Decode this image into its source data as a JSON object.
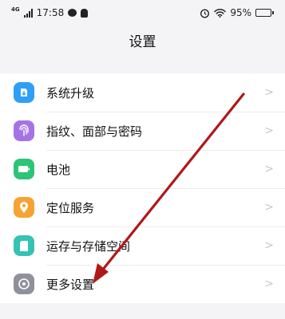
{
  "status_bar": {
    "network": "4G",
    "time": "17:58",
    "battery": "95%",
    "battery_level": 0.95
  },
  "header": {
    "title": "设置"
  },
  "settings": [
    {
      "label": "系统升级",
      "color": "#2f9ff6",
      "icon": "system-update-icon"
    },
    {
      "label": "指纹、面部与密码",
      "color": "#a573e6",
      "icon": "fingerprint-face-icon"
    },
    {
      "label": "电池",
      "color": "#2cc477",
      "icon": "battery-icon"
    },
    {
      "label": "定位服务",
      "color": "#f6a334",
      "icon": "location-icon"
    },
    {
      "label": "运存与存储空间",
      "color": "#34c3b4",
      "icon": "storage-icon"
    },
    {
      "label": "更多设置",
      "color": "#8e9199",
      "icon": "more-settings-icon"
    }
  ],
  "annotation": {
    "arrow_color": "#b01818"
  }
}
